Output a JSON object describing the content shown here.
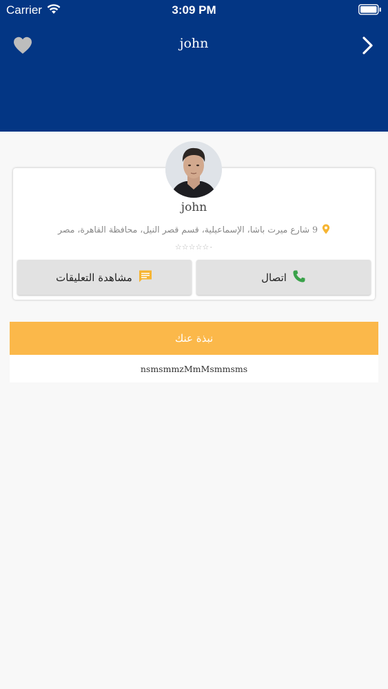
{
  "status_bar": {
    "carrier": "Carrier",
    "time": "3:09 PM"
  },
  "nav": {
    "title": "john",
    "favorite_icon": "heart-icon",
    "forward_icon": "chevron-right-icon"
  },
  "profile": {
    "name": "john",
    "address": "9 شارع ميرت باشا، الإسماعيلية، قسم قصر النيل، محافظة القاهرة، مصر",
    "rating_text": "☆☆☆☆☆٠",
    "rating_value": 0,
    "rating_max": 5
  },
  "actions": {
    "call_label": "اتصال",
    "comments_label": "مشاهدة التعليقات"
  },
  "about": {
    "title": "نبذة عنك",
    "text": "nsmsmmzMmMsmmsms"
  },
  "colors": {
    "header": "#033684",
    "accent": "#fbb84a",
    "phone_icon": "#3aa24a",
    "comment_icon": "#f6b533",
    "pin_icon": "#f6b533"
  }
}
